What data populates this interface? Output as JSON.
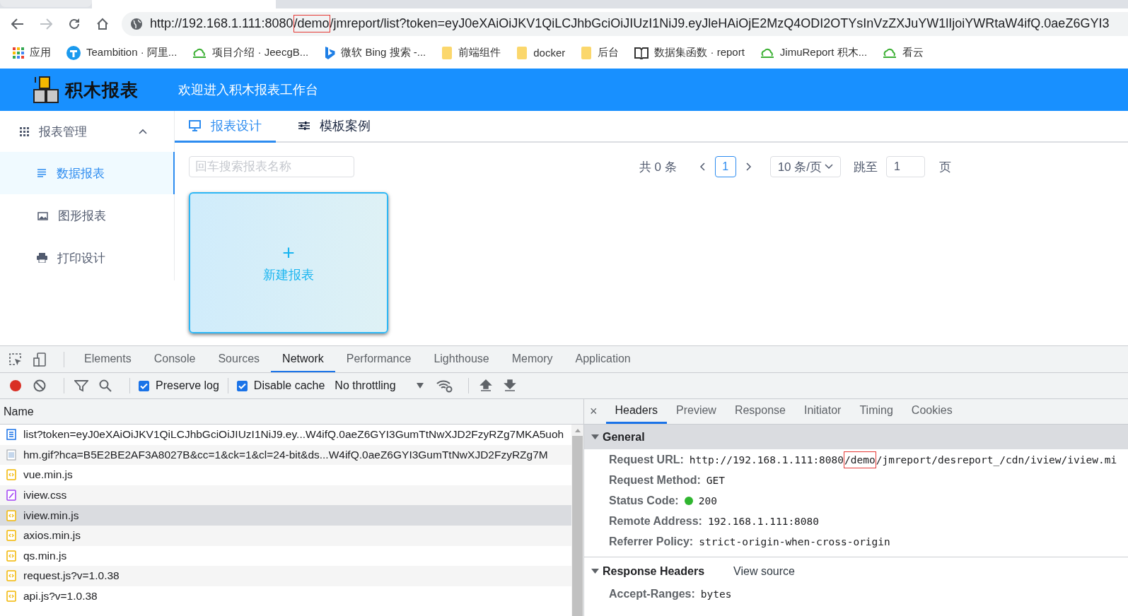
{
  "browser": {
    "url": {
      "before": "http://192.168.1.111:8080",
      "highlighted": "/demo",
      "after": "/jmreport/list?token=eyJ0eXAiOiJKV1QiLCJhbGciOiJIUzI1NiJ9.eyJleHAiOjE2MzQ4ODI2OTYsInVzZXJuYW1lIjoiYWRtaW4ifQ.0aeZ6GYI3"
    },
    "bookmarks": [
      {
        "kind": "apps",
        "label": "应用"
      },
      {
        "kind": "teambition",
        "label": "Teambition · 阿里..."
      },
      {
        "kind": "cloud",
        "label": "项目介绍 · JeecgB..."
      },
      {
        "kind": "bing",
        "label": "微软 Bing 搜索 -..."
      },
      {
        "kind": "folder",
        "label": "前端组件"
      },
      {
        "kind": "folder",
        "label": "docker"
      },
      {
        "kind": "folder",
        "label": "后台"
      },
      {
        "kind": "book",
        "label": "数据集函数 · report"
      },
      {
        "kind": "cloud",
        "label": "JimuReport 积木..."
      },
      {
        "kind": "cloud",
        "label": "看云"
      }
    ]
  },
  "header": {
    "logo_text": "积木报表",
    "welcome": "欢迎进入积木报表工作台"
  },
  "sidebar": {
    "group": {
      "label": "报表管理",
      "expanded": true
    },
    "items": [
      {
        "kind": "list",
        "label": "数据报表",
        "selected": true
      },
      {
        "kind": "image",
        "label": "图形报表",
        "selected": false
      },
      {
        "kind": "printer",
        "label": "打印设计",
        "selected": false
      }
    ]
  },
  "tabs": [
    {
      "kind": "monitor",
      "label": "报表设计",
      "selected": true
    },
    {
      "kind": "sliders",
      "label": "模板案例",
      "selected": false
    }
  ],
  "search": {
    "placeholder": "回车搜索报表名称"
  },
  "pagination": {
    "total": "共 0 条",
    "current_page": "1",
    "page_size": "10 条/页",
    "jump_label": "跳至",
    "jump_value": "1",
    "page_suffix": "页"
  },
  "new_report": {
    "plus": "+",
    "label": "新建报表"
  },
  "devtools": {
    "tabs": [
      {
        "label": "Elements",
        "selected": false
      },
      {
        "label": "Console",
        "selected": false
      },
      {
        "label": "Sources",
        "selected": false
      },
      {
        "label": "Network",
        "selected": true
      },
      {
        "label": "Performance",
        "selected": false
      },
      {
        "label": "Lighthouse",
        "selected": false
      },
      {
        "label": "Memory",
        "selected": false
      },
      {
        "label": "Application",
        "selected": false
      }
    ],
    "toolbar": {
      "recording": true,
      "preserve_log": {
        "label": "Preserve log",
        "checked": true
      },
      "disable_cache": {
        "label": "Disable cache",
        "checked": true
      },
      "throttling": "No throttling"
    },
    "requests_header": "Name",
    "requests": [
      {
        "kind": "doc",
        "name": "list?token=eyJ0eXAiOiJKV1QiLCJhbGciOiJIUzI1NiJ9.ey...W4ifQ.0aeZ6GYI3GumTtNwXJD2FzyRZg7MKA5uoh",
        "selected": false
      },
      {
        "kind": "image",
        "name": "hm.gif?hca=B5E2BE2AF3A8027B&cc=1&ck=1&cl=24-bit&ds...W4ifQ.0aeZ6GYI3GumTtNwXJD2FzyRZg7M",
        "selected": false
      },
      {
        "kind": "script",
        "name": "vue.min.js",
        "selected": false
      },
      {
        "kind": "style",
        "name": "iview.css",
        "selected": false
      },
      {
        "kind": "script",
        "name": "iview.min.js",
        "selected": true
      },
      {
        "kind": "script",
        "name": "axios.min.js",
        "selected": false
      },
      {
        "kind": "script",
        "name": "qs.min.js",
        "selected": false
      },
      {
        "kind": "script",
        "name": "request.js?v=1.0.38",
        "selected": false
      },
      {
        "kind": "script",
        "name": "api.js?v=1.0.38",
        "selected": false
      }
    ],
    "detail_close": "×",
    "detail_tabs": [
      {
        "label": "Headers",
        "selected": true
      },
      {
        "label": "Preview",
        "selected": false
      },
      {
        "label": "Response",
        "selected": false
      },
      {
        "label": "Initiator",
        "selected": false
      },
      {
        "label": "Timing",
        "selected": false
      },
      {
        "label": "Cookies",
        "selected": false
      }
    ],
    "general": {
      "title": "General",
      "expanded": true,
      "rows": [
        {
          "label": "Request URL:",
          "value": "http://192.168.1.111:8080",
          "highlighted": "/demo",
          "after": "/jmreport/desreport_/cdn/iview/iview.mi"
        },
        {
          "label": "Request Method:",
          "value": "GET"
        },
        {
          "label": "Status Code:",
          "value": "200",
          "color": "#2fb52f"
        },
        {
          "label": "Remote Address:",
          "value": "192.168.1.111:8080"
        },
        {
          "label": "Referrer Policy:",
          "value": "strict-origin-when-cross-origin"
        }
      ]
    },
    "response_headers": {
      "title": "Response Headers",
      "expanded": true,
      "link": "View source",
      "rows": [
        {
          "label": "Accept-Ranges:",
          "value": "bytes"
        }
      ]
    }
  }
}
